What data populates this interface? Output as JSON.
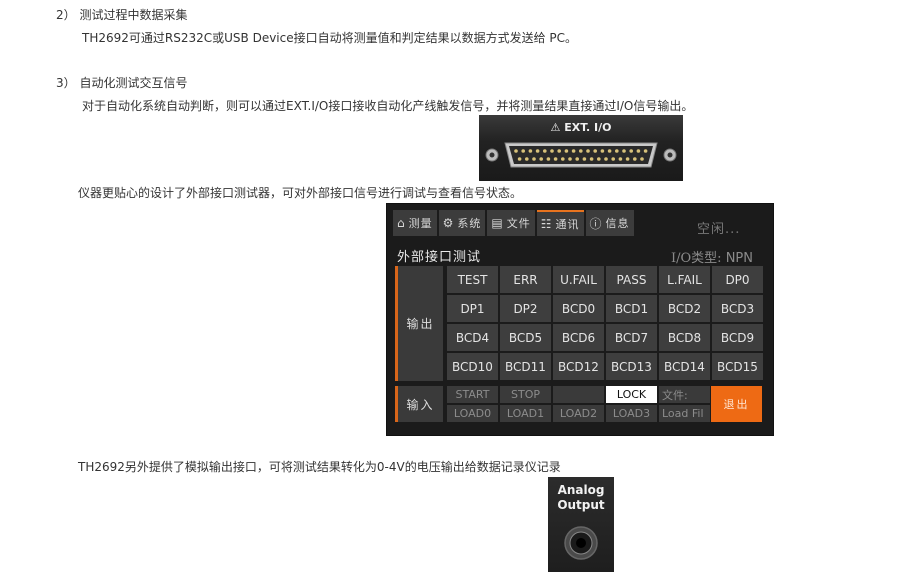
{
  "sections": [
    {
      "heading": "2）  测试过程中数据采集",
      "text": "TH2692可通过RS232C或USB Device接口自动将测量值和判定结果以数据方式发送给 PC。"
    },
    {
      "heading": "3）  自动化测试交互信号",
      "text": "对于自动化系统自动判断，则可以通过EXT.I/O接口接收自动化产线触发信号，并将测量结果直接通过I/O信号输出。"
    }
  ],
  "ext_io_label": "EXT. I/O",
  "tester_intro": "仪器更贴心的设计了外部接口测试器，可对外部接口信号进行调试与查看信号状态。",
  "screen": {
    "tabs": [
      {
        "icon": "⌂",
        "label": "测量"
      },
      {
        "icon": "⚙",
        "label": "系统"
      },
      {
        "icon": "▤",
        "label": "文件"
      },
      {
        "icon": "☷",
        "label": "通讯"
      },
      {
        "icon": "ⓘ",
        "label": "信息"
      }
    ],
    "status": "空闲...",
    "title": "外部接口测试",
    "io_type_label": "I/O类型:",
    "io_type_value": "NPN",
    "output_label": "输出",
    "outputs": [
      "TEST",
      "ERR",
      "U.FAIL",
      "PASS",
      "L.FAIL",
      "DP0",
      "DP1",
      "DP2",
      "BCD0",
      "BCD1",
      "BCD2",
      "BCD3",
      "BCD4",
      "BCD5",
      "BCD6",
      "BCD7",
      "BCD8",
      "BCD9",
      "BCD10",
      "BCD11",
      "BCD12",
      "BCD13",
      "BCD14",
      "BCD15"
    ],
    "input_label": "输入",
    "inputs_row1": [
      "START",
      "STOP",
      "",
      "LOCK",
      "文件:"
    ],
    "inputs_row2": [
      "LOAD0",
      "LOAD1",
      "LOAD2",
      "LOAD3",
      "Load Fil"
    ],
    "exit_label": "退出"
  },
  "analog_intro": "TH2692另外提供了模拟输出接口，可将测试结果转化为0-4V的电压输出给数据记录仪记录",
  "analog_label_line1": "Analog",
  "analog_label_line2": "Output",
  "colors": {
    "accent": "#ee6a14",
    "screen_bg": "#1b1b1b",
    "cell_bg": "#3e3e3e"
  }
}
